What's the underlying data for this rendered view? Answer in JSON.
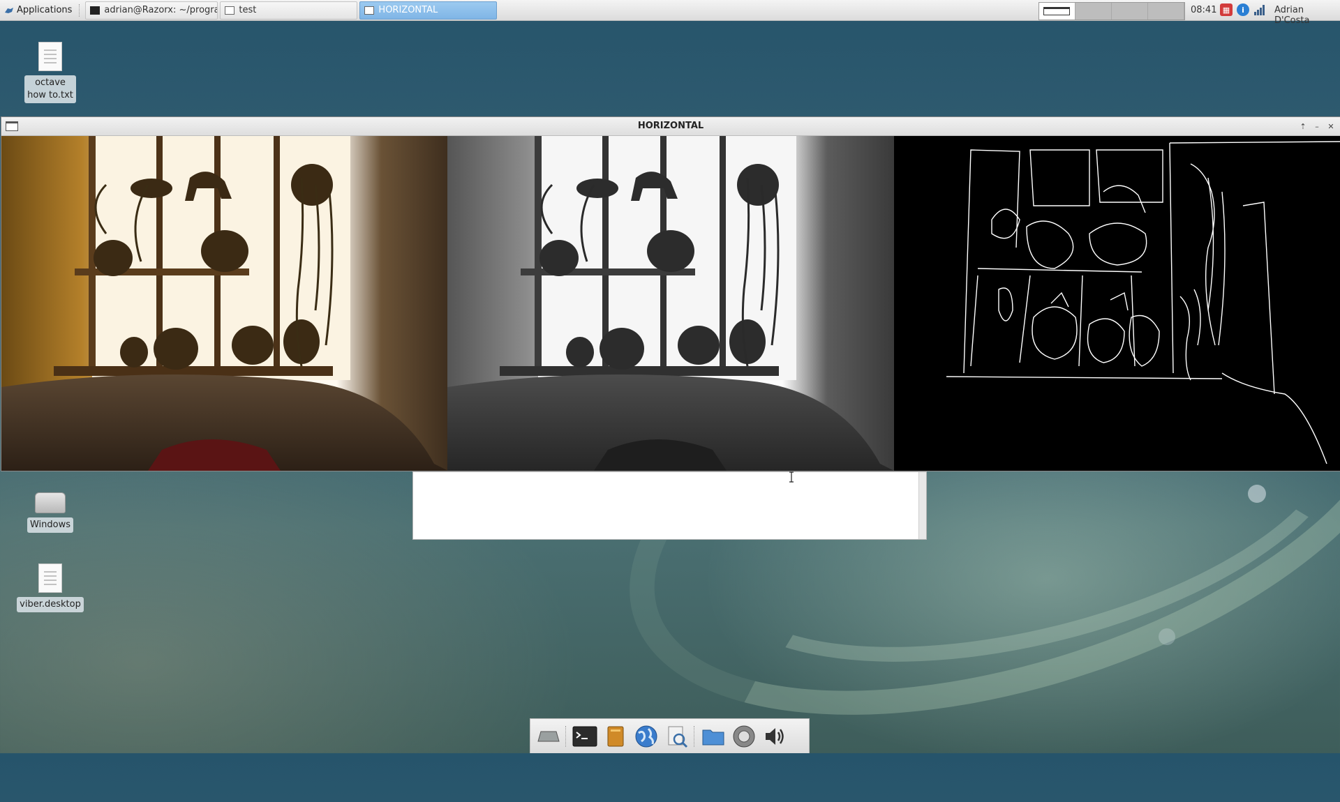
{
  "top_panel": {
    "applications_label": "Applications",
    "tasks": [
      {
        "label": "adrian@Razorx: ~/progra...",
        "icon": "terminal-icon"
      },
      {
        "label": "test",
        "icon": "window-icon"
      },
      {
        "label": "HORIZONTAL",
        "icon": "window-icon",
        "active": true
      }
    ],
    "clock": "08:41",
    "user": "Adrian D'Costa",
    "tray_icons": [
      "calendar-icon",
      "info-icon",
      "network-signal-icon"
    ]
  },
  "desktop_icons": [
    {
      "label": "octave how to.txt",
      "icon": "text-file-icon"
    },
    {
      "label": "Windows",
      "icon": "drive-icon"
    },
    {
      "label": "viber.desktop",
      "icon": "text-file-icon"
    }
  ],
  "window": {
    "title": "HORIZONTAL",
    "panes": [
      "color-camera-image",
      "grayscale-camera-image",
      "edge-detection-image"
    ]
  },
  "dock": {
    "items": [
      "show-desktop-icon",
      "terminal-icon",
      "file-manager-icon",
      "web-browser-icon",
      "search-icon",
      "folder-icon",
      "system-icon",
      "volume-icon"
    ]
  },
  "colors": {
    "active_task": "#8fc0ec",
    "panel_bg": "#e8e8e8"
  }
}
